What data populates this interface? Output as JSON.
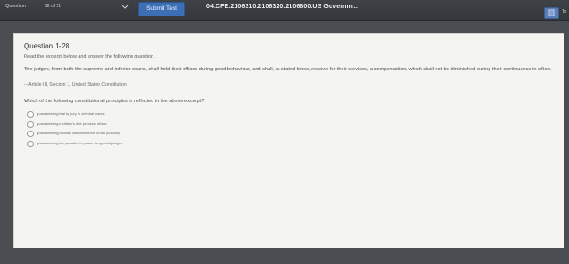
{
  "toolbar": {
    "question_label": "Question",
    "question_count": "28 of 51",
    "submit_label": "Submit Test",
    "test_title": "04.CFE.2106310.2106320.2106800.US Governm...",
    "tools_label": "To"
  },
  "question": {
    "title": "Question 1-28",
    "instructions": "Read the excerpt below and answer the following question.",
    "excerpt": "The judges, from both the supreme and inferior courts, shall hold their offices during good behaviour, and shall, at stated times, receive for their services, a compensation, which shall not be diminished during their continuance in office.",
    "citation": "---Article III, Section 1, United States Constitution",
    "prompt": "Which of the following constitutional principles is reflected in the above excerpt?",
    "choices": [
      {
        "label": "guaranteeing trial by jury in criminal cases"
      },
      {
        "label": "guaranteeing a citizen's due process of law"
      },
      {
        "label": "guaranteeing political independence of the judiciary"
      },
      {
        "label": "guaranteeing the president's power to appoint judges"
      }
    ]
  },
  "colors": {
    "toolbar_bg": "#3a3d41",
    "submit_button": "#3d6fb6",
    "panel_bg": "#f4f4f1"
  },
  "icons": {
    "dropdown": "chevron-down-icon",
    "calculator": "calculator-icon"
  }
}
